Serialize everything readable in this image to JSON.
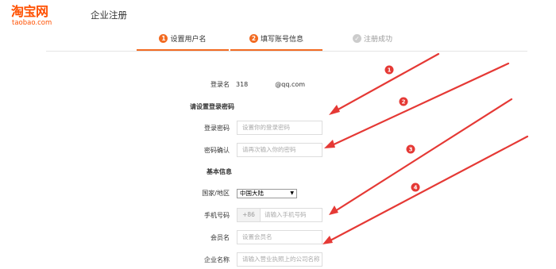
{
  "header": {
    "logo_cn": "淘宝网",
    "logo_en": "taobao.com",
    "page_title": "企业注册"
  },
  "steps": [
    {
      "num": "1",
      "label": "设置用户名",
      "state": "active"
    },
    {
      "num": "2",
      "label": "填写账号信息",
      "state": "active"
    },
    {
      "num": "✓",
      "label": "注册成功",
      "state": "done"
    }
  ],
  "form": {
    "login_label": "登录名",
    "login_prefix": "318",
    "login_suffix": "@qq.com",
    "password_section": "请设置登录密码",
    "password_label": "登录密码",
    "password_placeholder": "设置你的登录密码",
    "confirm_label": "密码确认",
    "confirm_placeholder": "请再次输入你的密码",
    "basic_section": "基本信息",
    "country_label": "国家/地区",
    "country_value": "中国大陆",
    "phone_label": "手机号码",
    "phone_prefix": "+86",
    "phone_placeholder": "请输入手机号码",
    "member_label": "会员名",
    "member_placeholder": "设置会员名",
    "company_label": "企业名称",
    "company_placeholder": "请输入营业执照上的公司名称"
  },
  "annotations": {
    "badges": [
      "1",
      "2",
      "3",
      "4"
    ],
    "color": "#e53935"
  }
}
